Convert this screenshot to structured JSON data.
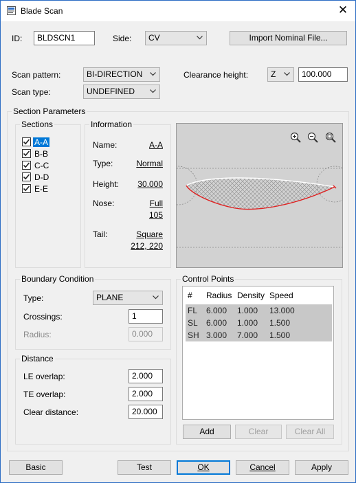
{
  "window": {
    "title": "Blade Scan"
  },
  "header": {
    "id_label": "ID:",
    "id_value": "BLDSCN1",
    "side_label": "Side:",
    "side_value": "CV",
    "import_button": "Import Nominal File..."
  },
  "scan": {
    "pattern_label": "Scan pattern:",
    "pattern_value": "BI-DIRECTION",
    "type_label": "Scan type:",
    "type_value": "UNDEFINED",
    "clearance_label": "Clearance height:",
    "clearance_axis": "Z",
    "clearance_value": "100.000"
  },
  "section_params": {
    "title": "Section Parameters",
    "sections_title": "Sections",
    "sections": [
      {
        "label": "A-A",
        "checked": true,
        "selected": true
      },
      {
        "label": "B-B",
        "checked": true,
        "selected": false
      },
      {
        "label": "C-C",
        "checked": true,
        "selected": false
      },
      {
        "label": "D-D",
        "checked": true,
        "selected": false
      },
      {
        "label": "E-E",
        "checked": true,
        "selected": false
      }
    ],
    "info_title": "Information",
    "info": {
      "name_label": "Name:",
      "name_value": "A-A",
      "type_label": "Type:",
      "type_value": "Normal",
      "height_label": "Height:",
      "height_value": "30.000",
      "nose_label": "Nose:",
      "nose_value": "Full",
      "nose_value2": "105",
      "tail_label": "Tail:",
      "tail_value": "Square",
      "tail_value2": "212, 220"
    }
  },
  "boundary": {
    "title": "Boundary Condition",
    "type_label": "Type:",
    "type_value": "PLANE",
    "crossings_label": "Crossings:",
    "crossings_value": "1",
    "radius_label": "Radius:",
    "radius_value": "0.000"
  },
  "distance": {
    "title": "Distance",
    "le_label": "LE overlap:",
    "le_value": "2.000",
    "te_label": "TE overlap:",
    "te_value": "2.000",
    "clear_label": "Clear distance:",
    "clear_value": "20.000"
  },
  "control_points": {
    "title": "Control Points",
    "columns": [
      "#",
      "Radius",
      "Density",
      "Speed"
    ],
    "rows": [
      [
        "FL",
        "6.000",
        "1.000",
        "13.000"
      ],
      [
        "SL",
        "6.000",
        "1.000",
        "1.500"
      ],
      [
        "SH",
        "3.000",
        "7.000",
        "1.500"
      ]
    ],
    "add_button": "Add",
    "clear_button": "Clear",
    "clear_all_button": "Clear All"
  },
  "footer": {
    "basic": "Basic",
    "test": "Test",
    "ok": "OK",
    "cancel": "Cancel",
    "apply": "Apply"
  },
  "colors": {
    "selection": "#0078d7",
    "profile_stroke": "#e02020",
    "preview_bg": "#d2d2d2"
  }
}
